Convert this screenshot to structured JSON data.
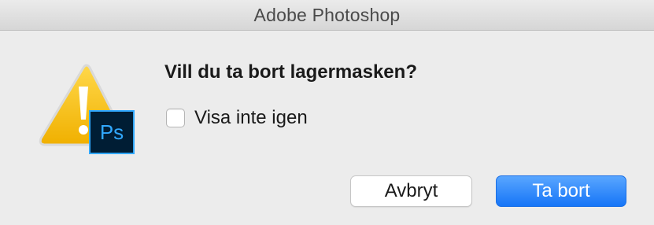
{
  "window": {
    "title": "Adobe Photoshop"
  },
  "icons": {
    "alert": "warning-icon",
    "app_badge_text": "Ps",
    "app_badge_color": "#001d34",
    "app_badge_accent": "#31a8ff",
    "warning_color": "#f5c200"
  },
  "message": {
    "text": "Vill du ta bort lagermasken?"
  },
  "suppress": {
    "label": "Visa inte igen",
    "checked": false
  },
  "buttons": {
    "cancel_label": "Avbryt",
    "confirm_label": "Ta bort",
    "confirm_color": "#1675f7"
  }
}
